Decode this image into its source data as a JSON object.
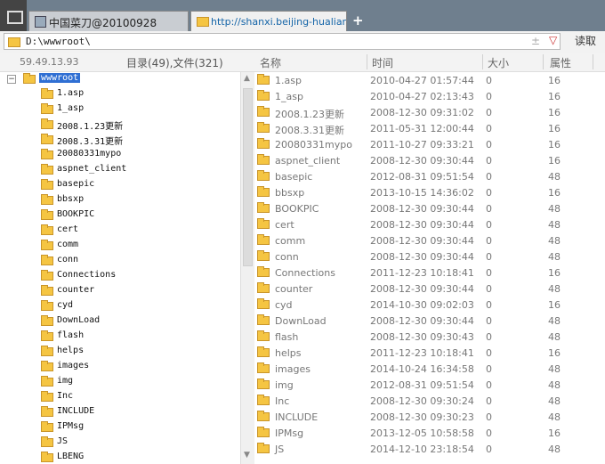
{
  "tabs": [
    {
      "label": "中国菜刀@20100928"
    },
    {
      "label": "http://shanxi.beijing-hualian.c..."
    }
  ],
  "new_tab_label": "+",
  "address": {
    "path": "D:\\wwwroot\\",
    "plus": "±",
    "dropdown": "▽"
  },
  "read_button": "读取",
  "tree_header": {
    "ip": "59.49.13.93",
    "counts": "目录(49),文件(321)"
  },
  "columns": {
    "name": "名称",
    "time": "时间",
    "size": "大小",
    "attr": "属性"
  },
  "tree": {
    "root": "wwwroot",
    "expander": "−",
    "items": [
      "1.asp",
      "1_asp",
      "2008.1.23更新",
      "2008.3.31更新",
      "20080331mypo",
      "aspnet_client",
      "basepic",
      "bbsxp",
      "BOOKPIC",
      "cert",
      "comm",
      "conn",
      "Connections",
      "counter",
      "cyd",
      "DownLoad",
      "flash",
      "helps",
      "images",
      "img",
      "Inc",
      "INCLUDE",
      "IPMsg",
      "JS",
      "LBENG"
    ]
  },
  "files": [
    {
      "name": "1.asp",
      "time": "2010-04-27 01:57:44",
      "size": "0",
      "attr": "16"
    },
    {
      "name": "1_asp",
      "time": "2010-04-27 02:13:43",
      "size": "0",
      "attr": "16"
    },
    {
      "name": "2008.1.23更新",
      "time": "2008-12-30 09:31:02",
      "size": "0",
      "attr": "16"
    },
    {
      "name": "2008.3.31更新",
      "time": "2011-05-31 12:00:44",
      "size": "0",
      "attr": "16"
    },
    {
      "name": "20080331mypo",
      "time": "2011-10-27 09:33:21",
      "size": "0",
      "attr": "16"
    },
    {
      "name": "aspnet_client",
      "time": "2008-12-30 09:30:44",
      "size": "0",
      "attr": "16"
    },
    {
      "name": "basepic",
      "time": "2012-08-31 09:51:54",
      "size": "0",
      "attr": "48"
    },
    {
      "name": "bbsxp",
      "time": "2013-10-15 14:36:02",
      "size": "0",
      "attr": "16"
    },
    {
      "name": "BOOKPIC",
      "time": "2008-12-30 09:30:44",
      "size": "0",
      "attr": "48"
    },
    {
      "name": "cert",
      "time": "2008-12-30 09:30:44",
      "size": "0",
      "attr": "48"
    },
    {
      "name": "comm",
      "time": "2008-12-30 09:30:44",
      "size": "0",
      "attr": "48"
    },
    {
      "name": "conn",
      "time": "2008-12-30 09:30:44",
      "size": "0",
      "attr": "48"
    },
    {
      "name": "Connections",
      "time": "2011-12-23 10:18:41",
      "size": "0",
      "attr": "16"
    },
    {
      "name": "counter",
      "time": "2008-12-30 09:30:44",
      "size": "0",
      "attr": "48"
    },
    {
      "name": "cyd",
      "time": "2014-10-30 09:02:03",
      "size": "0",
      "attr": "16"
    },
    {
      "name": "DownLoad",
      "time": "2008-12-30 09:30:44",
      "size": "0",
      "attr": "48"
    },
    {
      "name": "flash",
      "time": "2008-12-30 09:30:43",
      "size": "0",
      "attr": "48"
    },
    {
      "name": "helps",
      "time": "2011-12-23 10:18:41",
      "size": "0",
      "attr": "16"
    },
    {
      "name": "images",
      "time": "2014-10-24 16:34:58",
      "size": "0",
      "attr": "48"
    },
    {
      "name": "img",
      "time": "2012-08-31 09:51:54",
      "size": "0",
      "attr": "48"
    },
    {
      "name": "Inc",
      "time": "2008-12-30 09:30:24",
      "size": "0",
      "attr": "48"
    },
    {
      "name": "INCLUDE",
      "time": "2008-12-30 09:30:23",
      "size": "0",
      "attr": "48"
    },
    {
      "name": "IPMsg",
      "time": "2013-12-05 10:58:58",
      "size": "0",
      "attr": "16"
    },
    {
      "name": "JS",
      "time": "2014-12-10 23:18:54",
      "size": "0",
      "attr": "48"
    }
  ]
}
